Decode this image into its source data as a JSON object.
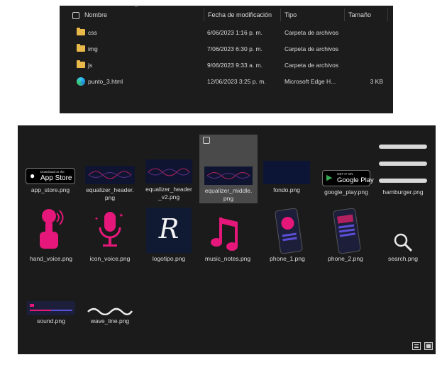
{
  "details": {
    "headers": {
      "name": "Nombre",
      "modified": "Fecha de modificación",
      "type": "Tipo",
      "size": "Tamaño"
    },
    "rows": [
      {
        "icon": "folder-icon",
        "name": "css",
        "modified": "6/06/2023 1:16 p. m.",
        "type": "Carpeta de archivos",
        "size": ""
      },
      {
        "icon": "folder-icon",
        "name": "img",
        "modified": "7/06/2023 6:30 p. m.",
        "type": "Carpeta de archivos",
        "size": ""
      },
      {
        "icon": "folder-icon",
        "name": "js",
        "modified": "9/06/2023 9:33 a. m.",
        "type": "Carpeta de archivos",
        "size": ""
      },
      {
        "icon": "edge-icon",
        "name": "punto_3.html",
        "modified": "12/06/2023 3:25 p. m.",
        "type": "Microsoft Edge H...",
        "size": "3 KB"
      }
    ]
  },
  "icons": {
    "files": [
      {
        "name": "app_store.png",
        "badge_small": "Download on the",
        "badge_large": "App Store"
      },
      {
        "name": "equalizer_header.\npng"
      },
      {
        "name": "equalizer_header\n_v2.png"
      },
      {
        "name": "equalizer_middle.\npng",
        "selected": true
      },
      {
        "name": "fondo.png"
      },
      {
        "name": "google_play.png",
        "badge_small": "GET IT ON",
        "badge_large": "Google Play"
      },
      {
        "name": "hamburger.png"
      },
      {
        "name": "hand_voice.png"
      },
      {
        "name": "icon_voice.png"
      },
      {
        "name": "logotipo.png",
        "logo_letter": "R"
      },
      {
        "name": "music_notes.png"
      },
      {
        "name": "phone_1.png"
      },
      {
        "name": "phone_2.png"
      },
      {
        "name": "search.png"
      },
      {
        "name": "sound.png"
      },
      {
        "name": "wave_line.png"
      }
    ]
  },
  "colors": {
    "panel_bg": "#1c1c1c",
    "folder": "#e8b84a",
    "accent_pink": "#e5177a",
    "equalizer_bg": "#0f1530"
  }
}
